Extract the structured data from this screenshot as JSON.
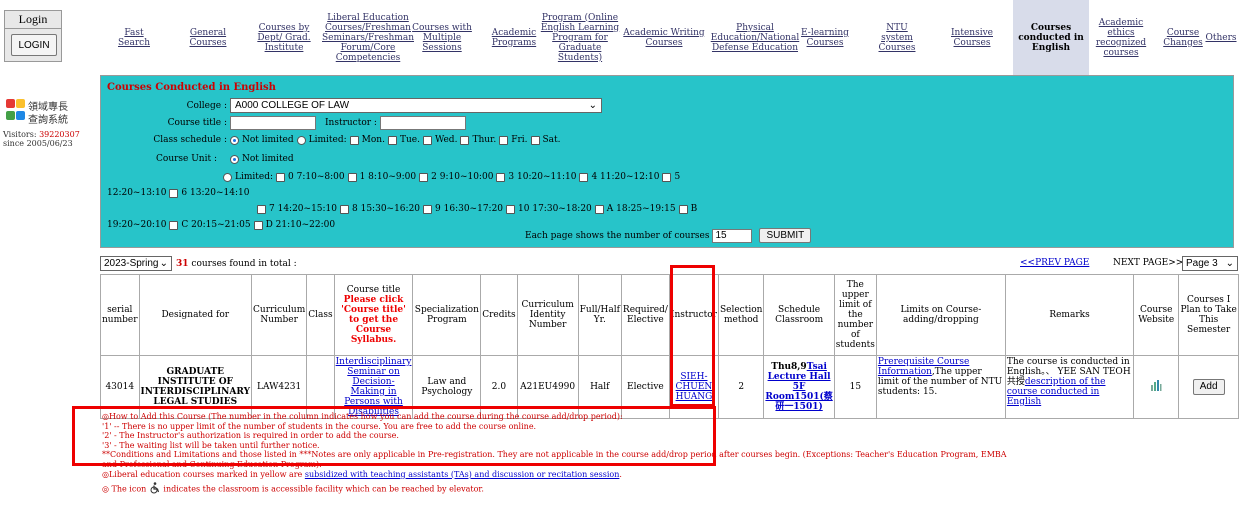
{
  "login": {
    "title": "Login",
    "button": "LOGIN"
  },
  "logo": {
    "line1": "領域專長",
    "line2": "查詢系統"
  },
  "visitors": {
    "label": "Visitors: ",
    "count": "39220307",
    "since": "since 2005/06/23"
  },
  "nav": [
    {
      "label": "Fast Search"
    },
    {
      "label": "General Courses"
    },
    {
      "label": "Courses by Dept/ Grad. Institute"
    },
    {
      "label": "Liberal Education Courses/Freshman Seminars/Freshman Forum/Core Competencies"
    },
    {
      "label": "Courses with Multiple Sessions"
    },
    {
      "label": "Academic Programs"
    },
    {
      "label": "Program (Online English Learning Program for Graduate Students)"
    },
    {
      "label": "Academic Writing Courses"
    },
    {
      "label": "Physical Education/National Defense Education"
    },
    {
      "label": "E-learning Courses"
    },
    {
      "label": "NTU system Courses"
    },
    {
      "label": "Intensive Courses"
    },
    {
      "label": "Courses conducted in English"
    },
    {
      "label": "Academic ethics recognized courses"
    },
    {
      "label": "Course Changes"
    },
    {
      "label": "Others"
    }
  ],
  "form": {
    "title": "Courses Conducted in English",
    "college_label": "College :",
    "college_value": "A000 COLLEGE OF LAW",
    "course_title_label": "Course title :",
    "instructor_label": "Instructor :",
    "schedule_label": "Class schedule :",
    "not_limited": "Not limited",
    "limited": "Limited:",
    "days": [
      "Mon.",
      "Tue.",
      "Wed.",
      "Thur.",
      "Fri.",
      "Sat."
    ],
    "unit_label": "Course Unit :",
    "unit_not_limited": "Not limited",
    "unit_limited": "Limited:",
    "units_row1": [
      "0 7:10~8:00",
      "1 8:10~9:00",
      "2 9:10~10:00",
      "3 10:20~11:10",
      "4 11:20~12:10",
      "5"
    ],
    "units_row2_pre": "12:20~13:10",
    "units_row2": [
      "6 13:20~14:10"
    ],
    "units_row3": [
      "7 14:20~15:10",
      "8 15:30~16:20",
      "9 16:30~17:20",
      "10 17:30~18:20",
      "A 18:25~19:15",
      "B"
    ],
    "units_row4_pre": "19:20~20:10",
    "units_row4": [
      "C 20:15~21:05",
      "D 21:10~22:00"
    ],
    "per_page_label": "Each page shows the number of courses",
    "per_page_value": "15",
    "submit": "SUBMIT"
  },
  "results": {
    "semester": "2023-Spring",
    "count": "31",
    "found_text": "courses found in total :",
    "prev": "<<PREV PAGE",
    "next": "NEXT PAGE>>",
    "page": "Page 3"
  },
  "table": {
    "headers": {
      "serial": "serial number",
      "designated": "Designated for",
      "curriculum": "Curriculum Number",
      "class": "Class",
      "course_title": "Course title",
      "course_title_note": "Please click 'Course title' to get the Course Syllabus.",
      "specialization": "Specialization Program",
      "credits": "Credits",
      "identity": "Curriculum Identity Number",
      "fullhalf": "Full/Half Yr.",
      "required": "Required/ Elective",
      "instructor": "Instructor",
      "selection": "Selection method",
      "schedule": "Schedule Classroom",
      "upper": "The upper limit of the number of students",
      "limits": "Limits on Course-adding/dropping",
      "remarks": "Remarks",
      "website": "Course Website",
      "plan": "Courses I Plan to Take This Semester"
    },
    "row": {
      "serial": "43014",
      "designated": "GRADUATE INSTITUTE OF INTERDISCIPLINARY LEGAL STUDIES",
      "curriculum": "LAW4231",
      "class": "",
      "course_title": "Interdisciplinary Seminar on Decision-Making in Persons with Disabilities",
      "specialization": "Law and Psychology",
      "credits": "2.0",
      "identity": "A21EU4990",
      "fullhalf": "Half",
      "required": "Elective",
      "instructor": "SIEH-CHUEN HUANG",
      "selection": "2",
      "schedule_time": "Thu8,9",
      "schedule_room": "Tsai Lecture Hall 5F Room1501(蔡研一1501)",
      "upper": "15",
      "limits_link": "Prerequisite Course Information",
      "limits_text": ",The upper limit of the number of NTU students: 15.",
      "remarks_text": "The course is conducted in English。、 YEE SAN TEOH共授",
      "remarks_link": "description of the course conducted in English",
      "add": "Add"
    }
  },
  "notes": [
    "◎How to Add this Course (The number in the column indicates how you can add the course during the course add/drop period):",
    "'1' -- There is no upper limit of the number of students in the course. You are free to add the course online.",
    "'2' - The Instructor's authorization is required in order to add the course.",
    "'3' - The waiting list will be taken until further notice.",
    "**Conditions and Limitations and those listed in ***Notes are only applicable in Pre-registration. They are not applicable in the course add/drop period after courses begin. (Exceptions: Teacher's Education Program, EMBA",
    "and Professional and Continuing Education Program)."
  ],
  "note_liberal_pre": "◎Liberal education courses marked in yellow are ",
  "note_liberal_link": "subsidized with teaching assistants (TAs) and discussion or recitation session",
  "note_icon_pre": "◎ The icon",
  "note_icon_post": "indicates the classroom is accessible facility which can be reached by elevator.",
  "colors": {
    "panel": "#27c4c9",
    "highlight": "#e00000",
    "nav_active": "#d8dcea"
  }
}
